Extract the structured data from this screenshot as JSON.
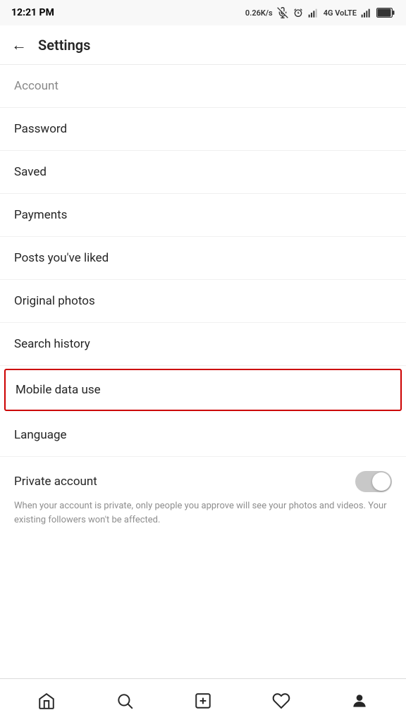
{
  "statusBar": {
    "time": "12:21 PM",
    "speed": "0.26K/s",
    "networkType": "4G VoLTE"
  },
  "header": {
    "backLabel": "←",
    "title": "Settings"
  },
  "settingsItems": [
    {
      "id": "account",
      "label": "Account",
      "highlighted": false
    },
    {
      "id": "password",
      "label": "Password",
      "highlighted": false
    },
    {
      "id": "saved",
      "label": "Saved",
      "highlighted": false
    },
    {
      "id": "payments",
      "label": "Payments",
      "highlighted": false
    },
    {
      "id": "posts-liked",
      "label": "Posts you've liked",
      "highlighted": false
    },
    {
      "id": "original-photos",
      "label": "Original photos",
      "highlighted": false
    },
    {
      "id": "search-history",
      "label": "Search history",
      "highlighted": false
    },
    {
      "id": "mobile-data-use",
      "label": "Mobile data use",
      "highlighted": true
    },
    {
      "id": "language",
      "label": "Language",
      "highlighted": false
    }
  ],
  "privateAccount": {
    "label": "Private account",
    "description": "When your account is private, only people you approve will see your photos and videos. Your existing followers won't be affected.",
    "enabled": false
  },
  "bottomNav": {
    "items": [
      {
        "id": "home",
        "label": "Home"
      },
      {
        "id": "search",
        "label": "Search"
      },
      {
        "id": "new-post",
        "label": "New Post"
      },
      {
        "id": "likes",
        "label": "Likes"
      },
      {
        "id": "profile",
        "label": "Profile"
      }
    ]
  }
}
